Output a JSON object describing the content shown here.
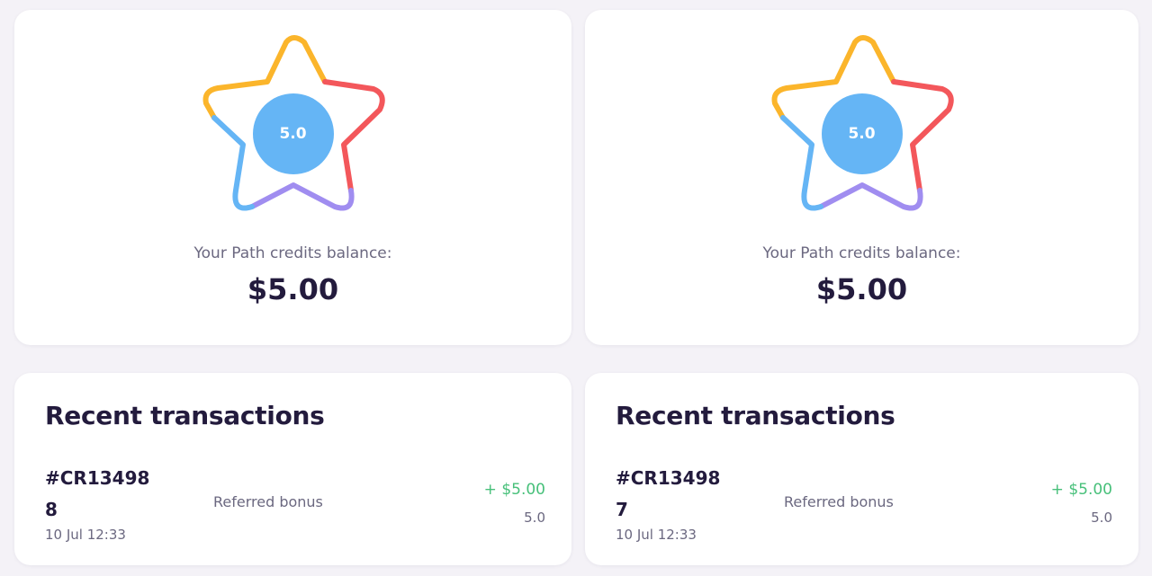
{
  "cards": [
    {
      "star_score": "5.0",
      "balance_label": "Your Path credits balance:",
      "balance_amount": "$5.00"
    },
    {
      "star_score": "5.0",
      "balance_label": "Your Path credits balance:",
      "balance_amount": "$5.00"
    }
  ],
  "transactions": [
    {
      "title": "Recent transactions",
      "rows": [
        {
          "id": "#CR134988",
          "description": "Referred bonus",
          "amount": "+ $5.00",
          "score": "5.0",
          "date": "10 Jul 12:33"
        }
      ]
    },
    {
      "title": "Recent transactions",
      "rows": [
        {
          "id": "#CR134987",
          "description": "Referred bonus",
          "amount": "+ $5.00",
          "score": "5.0",
          "date": "10 Jul 12:33"
        }
      ]
    }
  ],
  "colors": {
    "star_yellow": "#fbb52b",
    "star_red": "#f3575b",
    "star_purple": "#a08df0",
    "star_blue": "#65b5f5",
    "score_circle": "#65b5f5",
    "positive_amount": "#47c07a",
    "background": "#f4f2f7"
  }
}
